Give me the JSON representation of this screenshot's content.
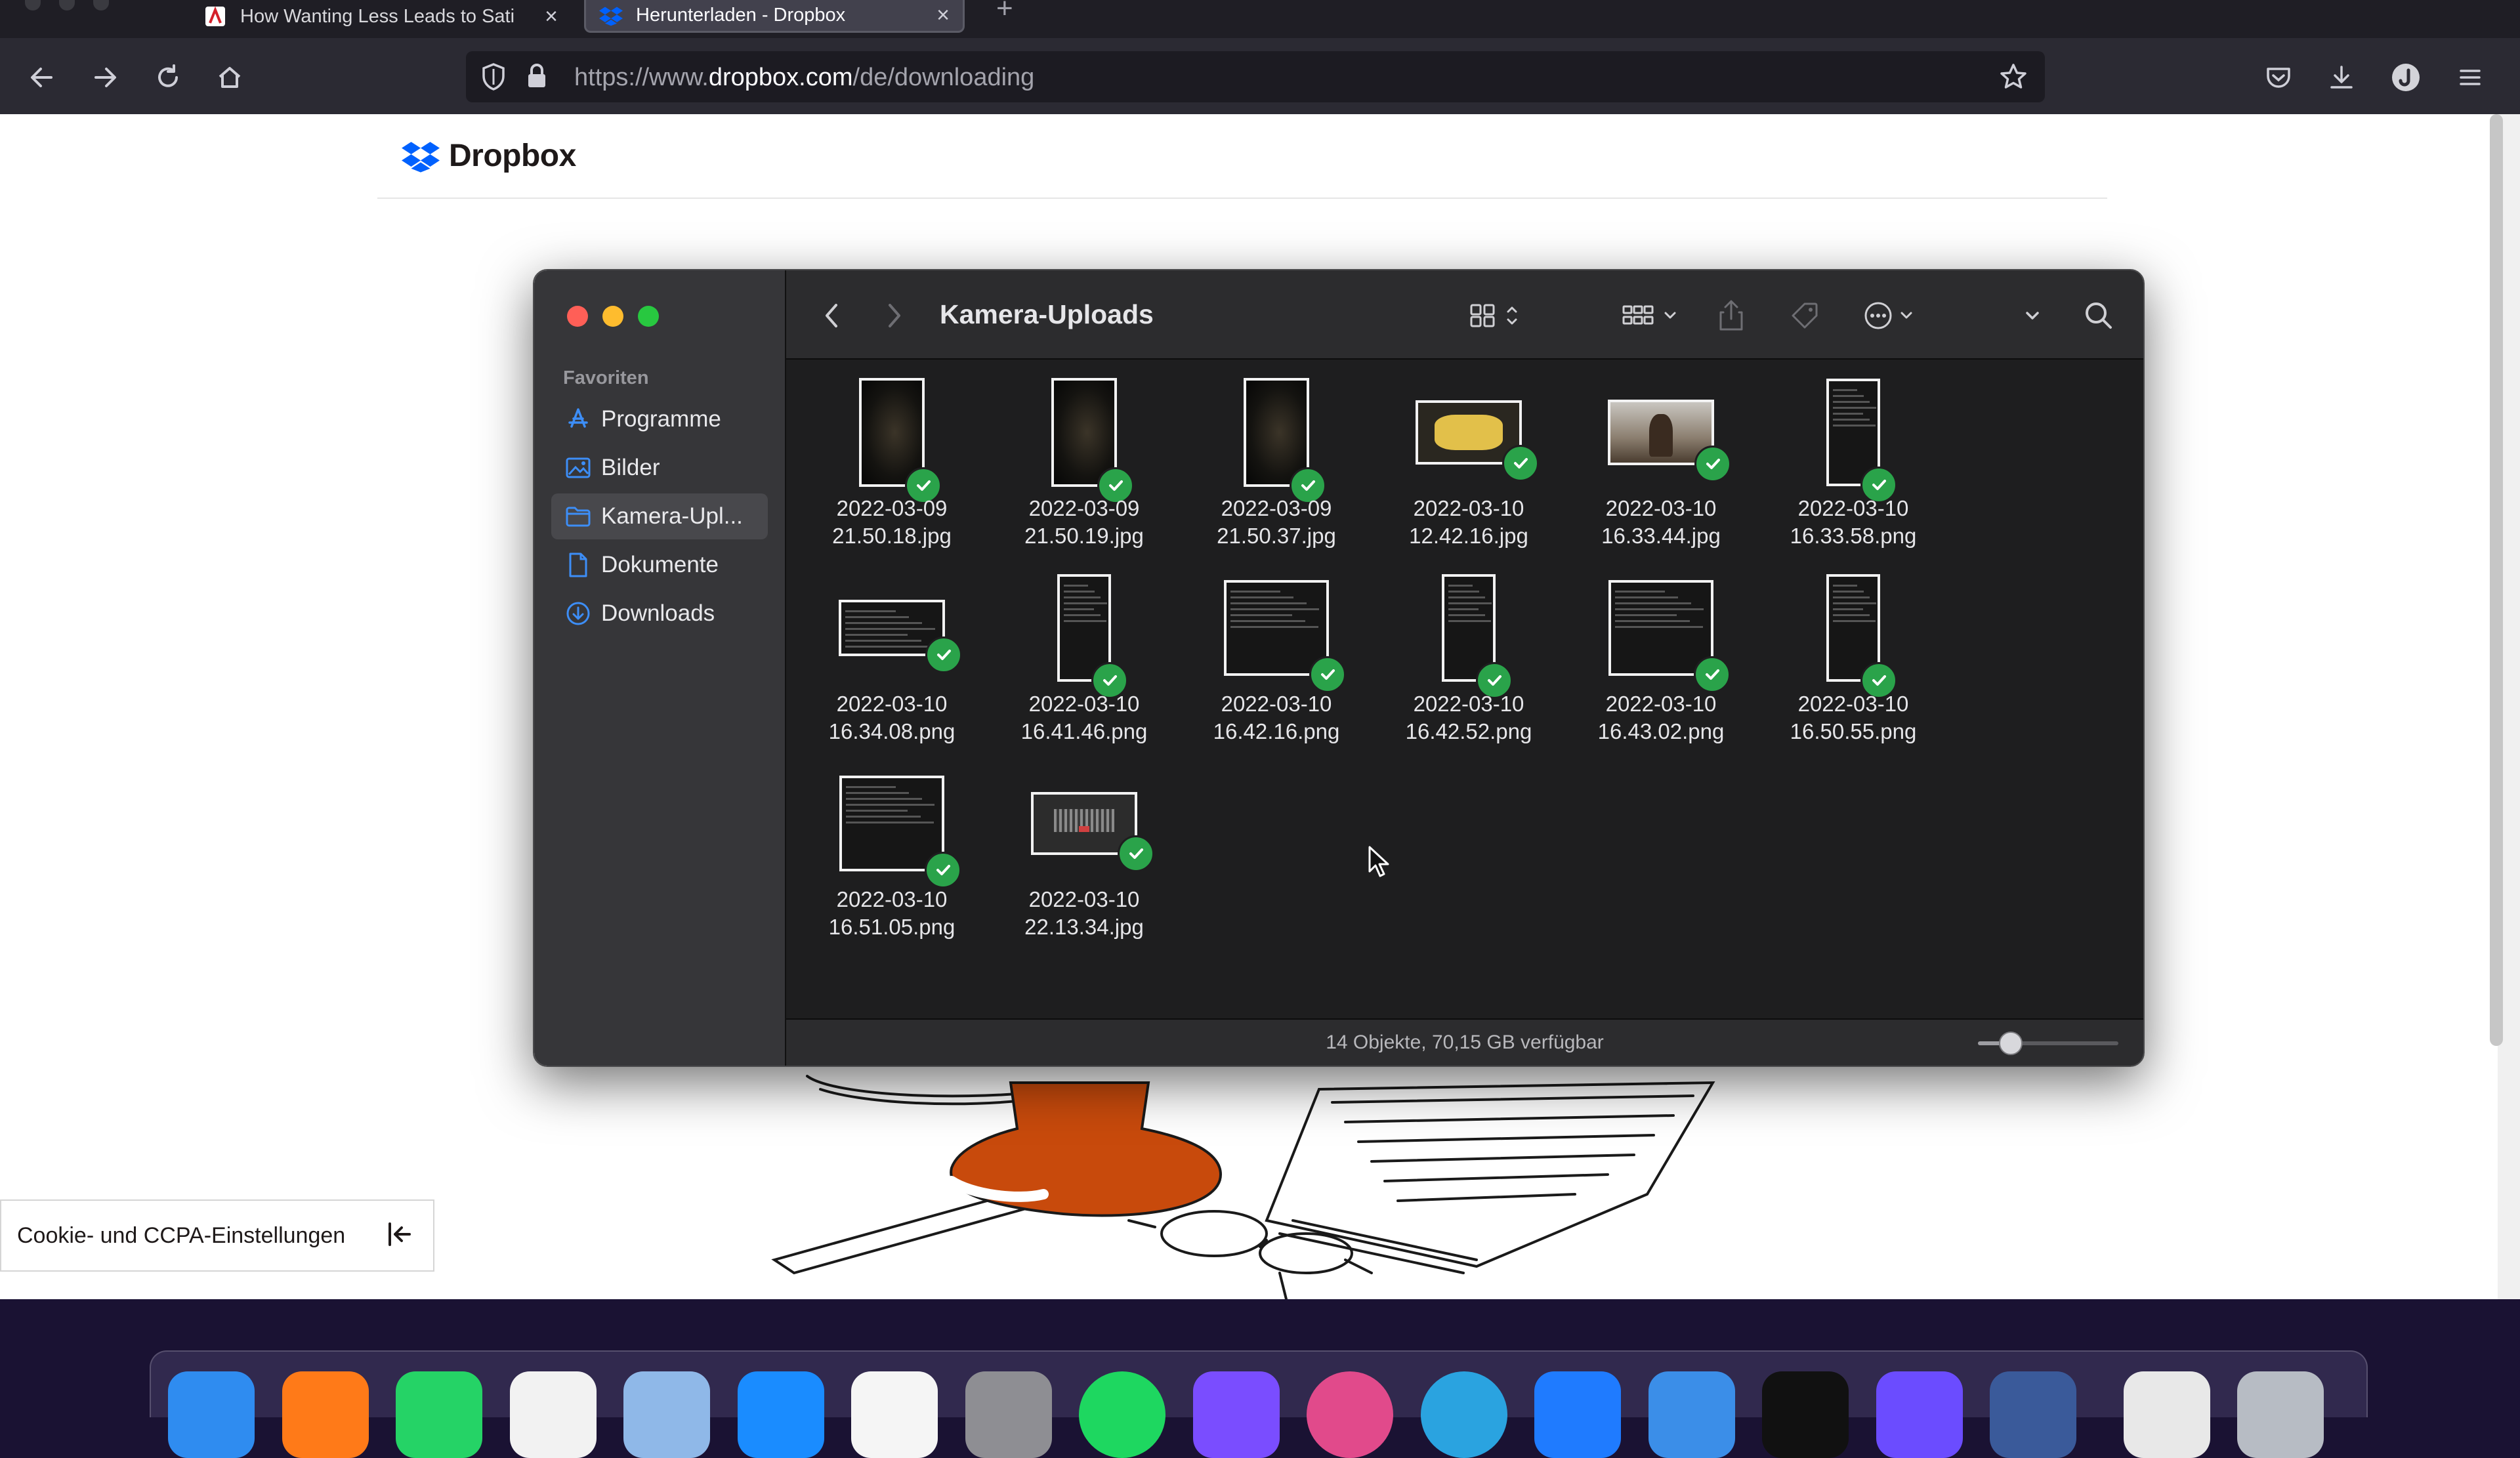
{
  "browser": {
    "tabs": [
      {
        "label": "How Wanting Less Leads to Sati",
        "icon": "pdf-icon",
        "active": false
      },
      {
        "label": "Herunterladen - Dropbox",
        "icon": "dropbox-icon",
        "active": true
      }
    ],
    "url": {
      "scheme": "https://www.",
      "host": "dropbox.com",
      "path": "/de/downloading"
    },
    "colors": {
      "chrome": "#2b2a33",
      "tabbar": "#1f1e25"
    }
  },
  "page": {
    "brand": "Dropbox",
    "brand_color": "#0061fe",
    "cookie_settings": "Cookie- und CCPA-Einstellungen"
  },
  "finder": {
    "title": "Kamera-Uploads",
    "sidebar": {
      "section": "Favoriten",
      "items": [
        {
          "label": "Programme",
          "icon": "applications-icon",
          "selected": false
        },
        {
          "label": "Bilder",
          "icon": "pictures-icon",
          "selected": false
        },
        {
          "label": "Kamera-Upl...",
          "icon": "folder-icon",
          "selected": true
        },
        {
          "label": "Dokumente",
          "icon": "document-icon",
          "selected": false
        },
        {
          "label": "Downloads",
          "icon": "downloads-icon",
          "selected": false
        }
      ]
    },
    "files": [
      {
        "line1": "2022-03-09",
        "line2": "21.50.18.jpg",
        "kind": "portrait-photo"
      },
      {
        "line1": "2022-03-09",
        "line2": "21.50.19.jpg",
        "kind": "portrait-photo"
      },
      {
        "line1": "2022-03-09",
        "line2": "21.50.37.jpg",
        "kind": "portrait-photo"
      },
      {
        "line1": "2022-03-10",
        "line2": "12.42.16.jpg",
        "kind": "landscape-yellow"
      },
      {
        "line1": "2022-03-10",
        "line2": "16.33.44.jpg",
        "kind": "landscape-photo"
      },
      {
        "line1": "2022-03-10",
        "line2": "16.33.58.png",
        "kind": "portrait-screenshot"
      },
      {
        "line1": "2022-03-10",
        "line2": "16.34.08.png",
        "kind": "landscape-screenshot"
      },
      {
        "line1": "2022-03-10",
        "line2": "16.41.46.png",
        "kind": "portrait-screenshot"
      },
      {
        "line1": "2022-03-10",
        "line2": "16.42.16.png",
        "kind": "square-screenshot"
      },
      {
        "line1": "2022-03-10",
        "line2": "16.42.52.png",
        "kind": "portrait-screenshot"
      },
      {
        "line1": "2022-03-10",
        "line2": "16.43.02.png",
        "kind": "square-screenshot"
      },
      {
        "line1": "2022-03-10",
        "line2": "16.50.55.png",
        "kind": "portrait-screenshot"
      },
      {
        "line1": "2022-03-10",
        "line2": "16.51.05.png",
        "kind": "square-screenshot"
      },
      {
        "line1": "2022-03-10",
        "line2": "22.13.34.jpg",
        "kind": "landscape-dark"
      }
    ],
    "status": "14 Objekte, 70,15 GB verfügbar",
    "zoom_level": 0.25,
    "sync_state": "synced",
    "colors": {
      "check": "#2aa34a",
      "sidebar": "#363639",
      "content": "#1e1e1f"
    }
  },
  "dock": {
    "apps": [
      {
        "name": "finder-icon",
        "color": "#2f8cf0"
      },
      {
        "name": "firefox-icon",
        "color": "#ff7a18"
      },
      {
        "name": "whatsapp-icon",
        "color": "#25d366"
      },
      {
        "name": "pages-icon",
        "color": "#f2f2f2"
      },
      {
        "name": "preview-icon",
        "color": "#8fb8e8"
      },
      {
        "name": "app-store-icon",
        "color": "#1a8cff"
      },
      {
        "name": "reminders-icon",
        "color": "#f5f5f5"
      },
      {
        "name": "system-preferences-icon",
        "color": "#8e8e93"
      },
      {
        "name": "spotify-icon",
        "color": "#1ed760"
      },
      {
        "name": "shortcuts-icon",
        "color": "#7a4dff"
      },
      {
        "name": "lightroom-icon",
        "color": "#e14a8b"
      },
      {
        "name": "telegram-icon",
        "color": "#2aa3e0"
      },
      {
        "name": "testflight-icon",
        "color": "#1f7bff"
      },
      {
        "name": "keynote-icon",
        "color": "#3b8ee8"
      },
      {
        "name": "apple-tv-icon",
        "color": "#111111"
      },
      {
        "name": "imovie-icon",
        "color": "#6b4cff"
      },
      {
        "name": "screen-sharing-icon",
        "color": "#3a5a9a"
      },
      {
        "name": "printer-icon",
        "color": "#e8e8e8"
      },
      {
        "name": "trash-icon",
        "color": "#b7bcc4"
      }
    ]
  }
}
